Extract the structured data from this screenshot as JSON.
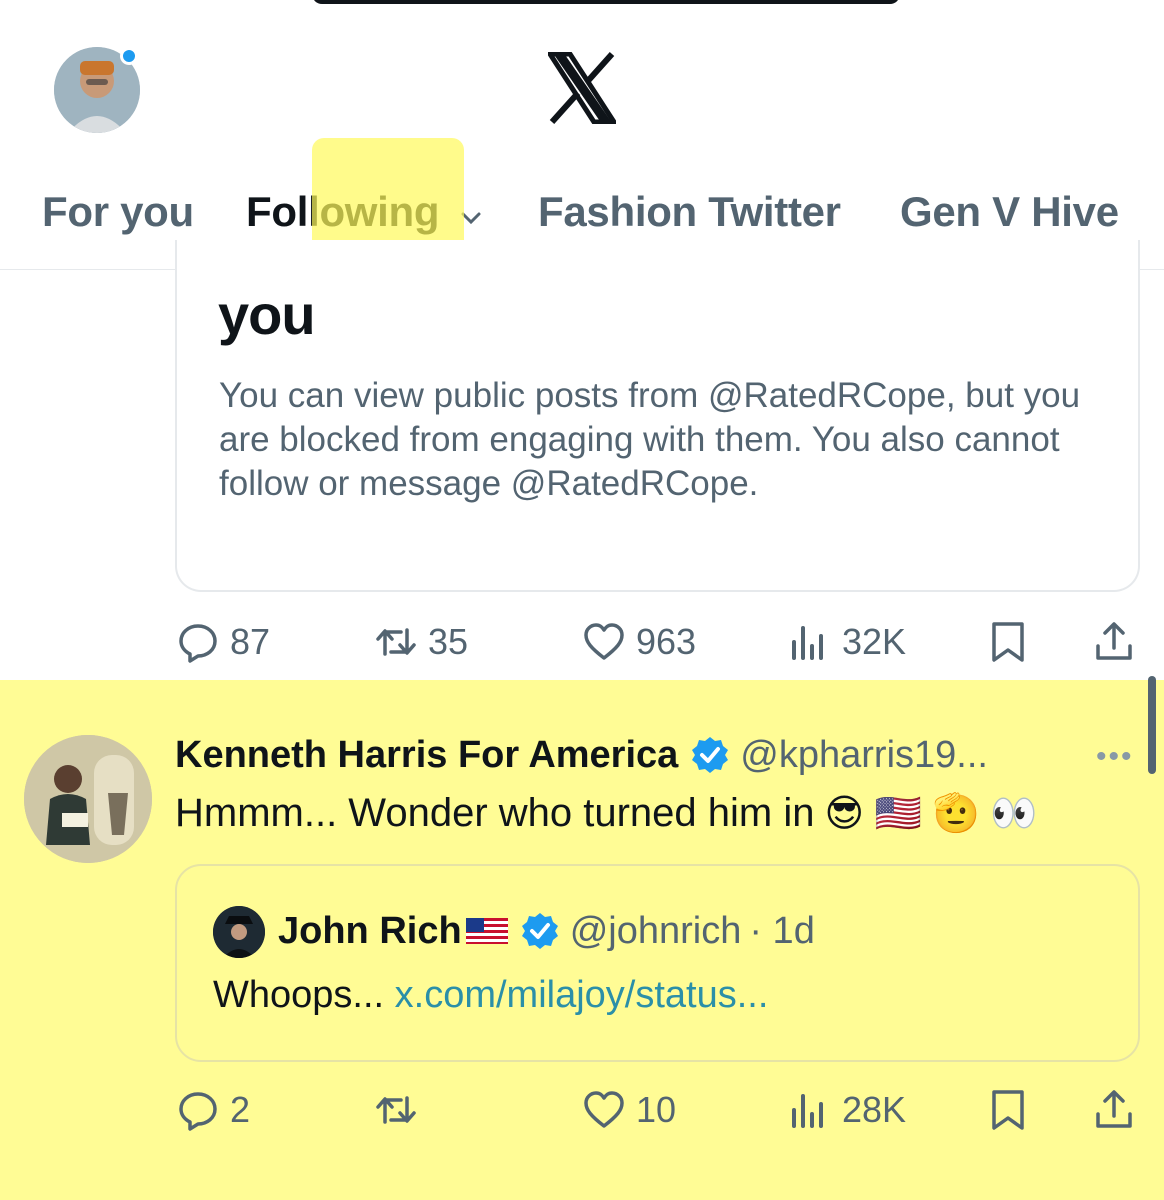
{
  "header": {
    "notification_dot_color": "#1d9bf0",
    "logo_icon": "x-logo-icon"
  },
  "tabs": [
    {
      "label": "For you",
      "active": false
    },
    {
      "label": "Following",
      "active": true
    },
    {
      "label": "Fashion Twitter",
      "active": false
    },
    {
      "label": "Gen V Hive",
      "active": false
    }
  ],
  "blocked_card": {
    "title": "you",
    "text": "You can view public posts from @RatedRCope, but you are blocked from engaging with them. You also cannot follow or message @RatedRCope."
  },
  "tweet1_actions": {
    "replies": "87",
    "reposts": "35",
    "likes": "963",
    "views": "32K"
  },
  "tweet2": {
    "author": "Kenneth Harris For America",
    "handle": "@kpharris19...",
    "text": "Hmmm... Wonder who turned him in",
    "emojis": "😎 🇺🇸 🫡 👀",
    "quote": {
      "author": "John Rich",
      "handle": "@johnrich",
      "time": "· 1d",
      "text": "Whoops...",
      "link": "x.com/milajoy/status..."
    },
    "actions": {
      "replies": "2",
      "reposts": "",
      "likes": "10",
      "views": "28K"
    }
  },
  "colors": {
    "accent": "#1d9bf0",
    "highlight": "#fffc95",
    "muted_text": "#536471",
    "verified": "#1d9bf0"
  }
}
